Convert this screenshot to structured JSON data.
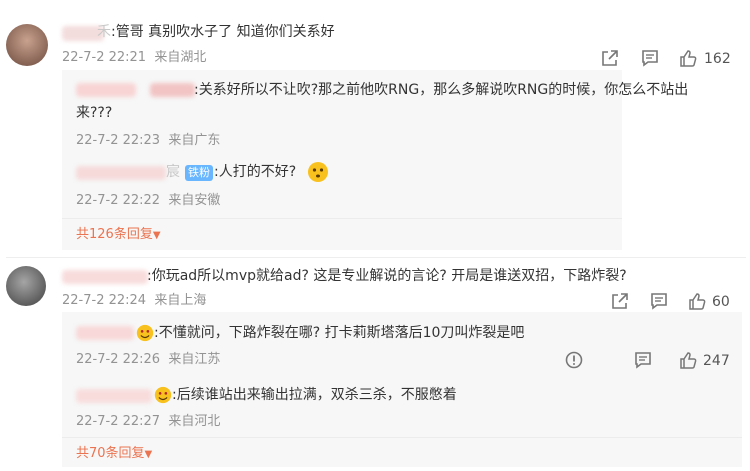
{
  "comments": [
    {
      "user_suffix": "禾",
      "text": ":管哥 真别吹水子了 知道你们关系好",
      "date": "22-7-2 22:21",
      "location": "来自湖北",
      "likes": "162",
      "replies": [
        {
          "text_line1": ":关系好所以不让吹?那之前他吹RNG，那么多解说吹RNG的时候，你怎么不站出",
          "text_line2": "来???",
          "date": "22-7-2 22:23",
          "location": "来自广东"
        },
        {
          "user_suffix": "宸",
          "badge": "铁粉",
          "text": ":人打的不好?",
          "date": "22-7-2 22:22",
          "location": "来自安徽"
        }
      ],
      "more_replies": "共126条回复"
    },
    {
      "text": ":你玩ad所以mvp就给ad? 这是专业解说的言论? 开局是谁送双招，下路炸裂?",
      "date": "22-7-2 22:24",
      "location": "来自上海",
      "likes": "60",
      "replies": [
        {
          "text": ":不懂就问，下路炸裂在哪? 打卡莉斯塔落后10刀叫炸裂是吧",
          "date": "22-7-2 22:26",
          "location": "来自江苏",
          "likes": "247"
        },
        {
          "text": ":后续谁站出来输出拉满，双杀三杀，不服憋着",
          "date": "22-7-2 22:27",
          "location": "来自河北"
        }
      ],
      "more_replies": "共70条回复"
    }
  ],
  "icons": [
    "share-icon",
    "comment-icon",
    "like-icon",
    "report-icon",
    "chevron-down-icon",
    "smile-emoji-icon"
  ],
  "colors": {
    "accent": "#eb7350",
    "badge": "#69b6ff",
    "meta": "#939393"
  }
}
